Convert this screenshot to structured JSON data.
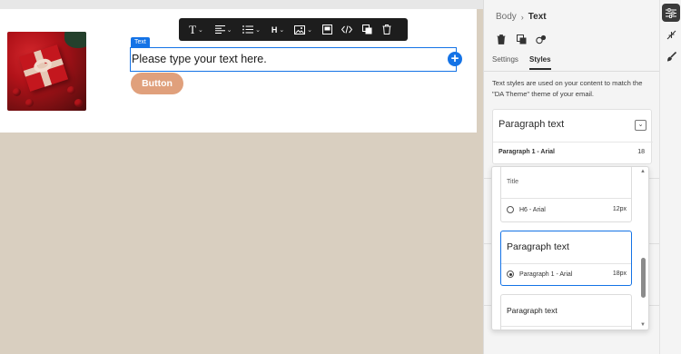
{
  "toolbar": {
    "font_style_icon": "T",
    "heading_label": "H",
    "items": [
      "text-style",
      "align",
      "list",
      "heading",
      "image",
      "background",
      "code",
      "copy",
      "delete"
    ]
  },
  "canvas": {
    "text_tag": "Text",
    "text_content": "Please type your text here.",
    "button_label": "Button",
    "accent_color": "#1473e6",
    "button_color": "#e0a07c"
  },
  "panel": {
    "breadcrumb": {
      "parent": "Body",
      "current": "Text"
    },
    "tabs": [
      {
        "label": "Settings",
        "active": false
      },
      {
        "label": "Styles",
        "active": true
      }
    ],
    "info_text": "Text styles are used on your content to match the \"DA Theme\" theme of your email.",
    "current_style": {
      "title": "Paragraph text",
      "meta": "Paragraph 1 - Arial",
      "size": "18"
    },
    "dropdown_options": [
      {
        "label": "Title",
        "meta": "H6 - Arial",
        "size": "12px",
        "selected": false
      },
      {
        "label": "Paragraph text",
        "meta": "Paragraph 1 - Arial",
        "size": "18px",
        "selected": true
      },
      {
        "label": "Paragraph text",
        "meta": "",
        "size": "",
        "selected": false
      }
    ]
  },
  "rail": {
    "items": [
      "settings-sliders-icon",
      "collapse-icon",
      "brush-icon"
    ]
  }
}
